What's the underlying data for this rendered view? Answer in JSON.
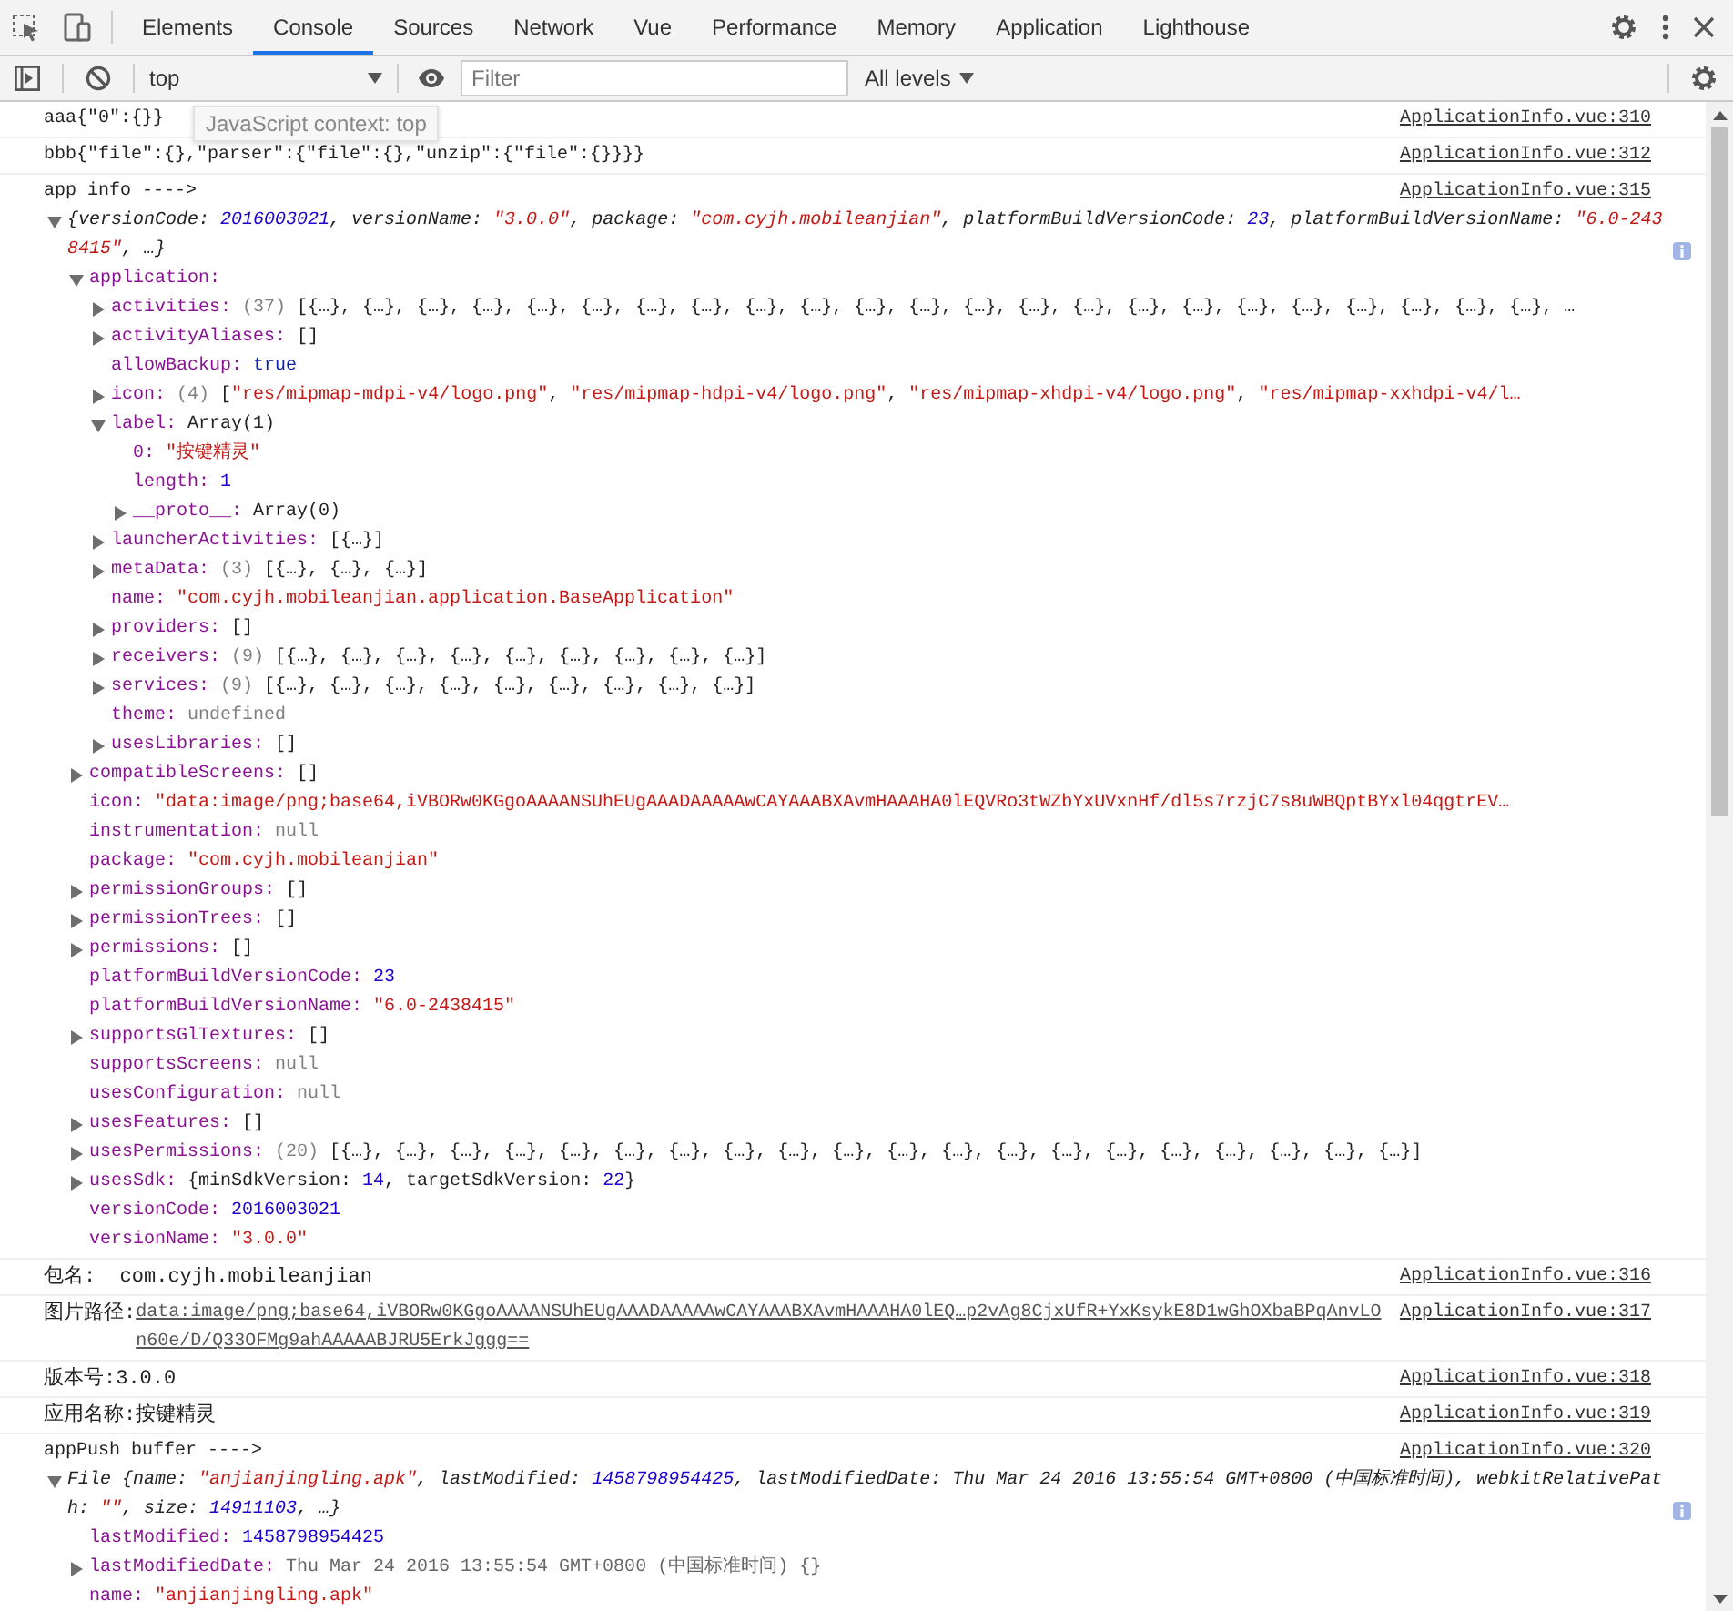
{
  "tabs": [
    {
      "label": "Elements",
      "selected": false
    },
    {
      "label": "Console",
      "selected": true
    },
    {
      "label": "Sources",
      "selected": false
    },
    {
      "label": "Network",
      "selected": false
    },
    {
      "label": "Vue",
      "selected": false
    },
    {
      "label": "Performance",
      "selected": false
    },
    {
      "label": "Memory",
      "selected": false
    },
    {
      "label": "Application",
      "selected": false
    },
    {
      "label": "Lighthouse",
      "selected": false
    }
  ],
  "toolbar": {
    "context": "top",
    "filter_placeholder": "Filter",
    "levels": "All levels"
  },
  "tooltip": "JavaScript context: top",
  "messages": [
    {
      "kind": "log",
      "text": "aaa{\"0\":{}}",
      "source": "ApplicationInfo.vue:310"
    },
    {
      "kind": "log",
      "text": "bbb{\"file\":{},\"parser\":{\"file\":{},\"unzip\":{\"file\":{}}}}",
      "source": "ApplicationInfo.vue:312"
    },
    {
      "kind": "object",
      "text": "app info ---->",
      "source": "ApplicationInfo.vue:315",
      "expanded": true,
      "summary": [
        {
          "kind": "plain",
          "text": "{versionCode: "
        },
        {
          "kind": "number",
          "text": "2016003021"
        },
        {
          "kind": "plain",
          "text": ", versionName: "
        },
        {
          "kind": "string",
          "text": "\"3.0.0\""
        },
        {
          "kind": "plain",
          "text": ", package: "
        },
        {
          "kind": "string",
          "text": "\"com.cyjh.mobileanjian\""
        },
        {
          "kind": "plain",
          "text": ", platformBuildVersionCode: "
        },
        {
          "kind": "number",
          "text": "23"
        },
        {
          "kind": "plain",
          "text": ", platformBuildVersionName: "
        },
        {
          "kind": "string",
          "text": "\"6.0-2438415\""
        },
        {
          "kind": "plain",
          "text": ", …}"
        }
      ],
      "children": [
        {
          "key": "application:",
          "kind": "branch",
          "expanded": true,
          "children": [
            {
              "key": "activities:",
              "kind": "branch",
              "expanded": false,
              "value": [
                {
                  "kind": "count",
                  "text": "(37)"
                },
                {
                  "kind": "plain",
                  "text": " [{…}, {…}, {…}, {…}, {…}, {…}, {…}, {…}, {…}, {…}, {…}, {…}, {…}, {…}, {…}, {…}, {…}, {…}, {…}, {…}, {…}, {…}, {…}, …"
                }
              ]
            },
            {
              "key": "activityAliases:",
              "kind": "branch",
              "expanded": false,
              "value": [
                {
                  "kind": "plain",
                  "text": "[]"
                }
              ]
            },
            {
              "key": "allowBackup:",
              "kind": "leaf",
              "value": [
                {
                  "kind": "boolean",
                  "text": "true"
                }
              ]
            },
            {
              "key": "icon:",
              "kind": "branch",
              "expanded": false,
              "value": [
                {
                  "kind": "count",
                  "text": "(4)"
                },
                {
                  "kind": "plain",
                  "text": " ["
                },
                {
                  "kind": "string",
                  "text": "\"res/mipmap-mdpi-v4/logo.png\""
                },
                {
                  "kind": "plain",
                  "text": ", "
                },
                {
                  "kind": "string",
                  "text": "\"res/mipmap-hdpi-v4/logo.png\""
                },
                {
                  "kind": "plain",
                  "text": ", "
                },
                {
                  "kind": "string",
                  "text": "\"res/mipmap-xhdpi-v4/logo.png\""
                },
                {
                  "kind": "plain",
                  "text": ", "
                },
                {
                  "kind": "string",
                  "text": "\"res/mipmap-xxhdpi-v4/l…"
                }
              ]
            },
            {
              "key": "label:",
              "kind": "branch",
              "expanded": true,
              "value": [
                {
                  "kind": "plain",
                  "text": "Array(1)"
                }
              ],
              "children": [
                {
                  "key": "0:",
                  "kind": "leaf",
                  "value": [
                    {
                      "kind": "string",
                      "text": "\"按键精灵\""
                    }
                  ]
                },
                {
                  "key": "length:",
                  "kind": "leaf",
                  "value": [
                    {
                      "kind": "number",
                      "text": "1"
                    }
                  ]
                },
                {
                  "key": "__proto__:",
                  "kind": "branch",
                  "expanded": false,
                  "value": [
                    {
                      "kind": "plain",
                      "text": "Array(0)"
                    }
                  ]
                }
              ]
            },
            {
              "key": "launcherActivities:",
              "kind": "branch",
              "expanded": false,
              "value": [
                {
                  "kind": "plain",
                  "text": "[{…}]"
                }
              ]
            },
            {
              "key": "metaData:",
              "kind": "branch",
              "expanded": false,
              "value": [
                {
                  "kind": "count",
                  "text": "(3)"
                },
                {
                  "kind": "plain",
                  "text": " [{…}, {…}, {…}]"
                }
              ]
            },
            {
              "key": "name:",
              "kind": "leaf",
              "value": [
                {
                  "kind": "string",
                  "text": "\"com.cyjh.mobileanjian.application.BaseApplication\""
                }
              ]
            },
            {
              "key": "providers:",
              "kind": "branch",
              "expanded": false,
              "value": [
                {
                  "kind": "plain",
                  "text": "[]"
                }
              ]
            },
            {
              "key": "receivers:",
              "kind": "branch",
              "expanded": false,
              "value": [
                {
                  "kind": "count",
                  "text": "(9)"
                },
                {
                  "kind": "plain",
                  "text": " [{…}, {…}, {…}, {…}, {…}, {…}, {…}, {…}, {…}]"
                }
              ]
            },
            {
              "key": "services:",
              "kind": "branch",
              "expanded": false,
              "value": [
                {
                  "kind": "count",
                  "text": "(9)"
                },
                {
                  "kind": "plain",
                  "text": " [{…}, {…}, {…}, {…}, {…}, {…}, {…}, {…}, {…}]"
                }
              ]
            },
            {
              "key": "theme:",
              "kind": "leaf",
              "value": [
                {
                  "kind": "null",
                  "text": "undefined"
                }
              ]
            },
            {
              "key": "usesLibraries:",
              "kind": "branch",
              "expanded": false,
              "value": [
                {
                  "kind": "plain",
                  "text": "[]"
                }
              ]
            }
          ]
        },
        {
          "key": "compatibleScreens:",
          "kind": "branch",
          "expanded": false,
          "value": [
            {
              "kind": "plain",
              "text": "[]"
            }
          ]
        },
        {
          "key": "icon:",
          "kind": "leaf",
          "value": [
            {
              "kind": "string",
              "text": "\"data:image/png;base64,iVBORw0KGgoAAAANSUhEUgAAADAAAAAwCAYAAABXAvmHAAAHA0lEQVRo3tWZbYxUVxnHf/dl5s7rzjC7s8uWBQptBYxl04qgtrEV…"
            }
          ]
        },
        {
          "key": "instrumentation:",
          "kind": "leaf",
          "value": [
            {
              "kind": "null",
              "text": "null"
            }
          ]
        },
        {
          "key": "package:",
          "kind": "leaf",
          "value": [
            {
              "kind": "string",
              "text": "\"com.cyjh.mobileanjian\""
            }
          ]
        },
        {
          "key": "permissionGroups:",
          "kind": "branch",
          "expanded": false,
          "value": [
            {
              "kind": "plain",
              "text": "[]"
            }
          ]
        },
        {
          "key": "permissionTrees:",
          "kind": "branch",
          "expanded": false,
          "value": [
            {
              "kind": "plain",
              "text": "[]"
            }
          ]
        },
        {
          "key": "permissions:",
          "kind": "branch",
          "expanded": false,
          "value": [
            {
              "kind": "plain",
              "text": "[]"
            }
          ]
        },
        {
          "key": "platformBuildVersionCode:",
          "kind": "leaf",
          "value": [
            {
              "kind": "number",
              "text": "23"
            }
          ]
        },
        {
          "key": "platformBuildVersionName:",
          "kind": "leaf",
          "value": [
            {
              "kind": "string",
              "text": "\"6.0-2438415\""
            }
          ]
        },
        {
          "key": "supportsGlTextures:",
          "kind": "branch",
          "expanded": false,
          "value": [
            {
              "kind": "plain",
              "text": "[]"
            }
          ]
        },
        {
          "key": "supportsScreens:",
          "kind": "leaf",
          "value": [
            {
              "kind": "null",
              "text": "null"
            }
          ]
        },
        {
          "key": "usesConfiguration:",
          "kind": "leaf",
          "value": [
            {
              "kind": "null",
              "text": "null"
            }
          ]
        },
        {
          "key": "usesFeatures:",
          "kind": "branch",
          "expanded": false,
          "value": [
            {
              "kind": "plain",
              "text": "[]"
            }
          ]
        },
        {
          "key": "usesPermissions:",
          "kind": "branch",
          "expanded": false,
          "value": [
            {
              "kind": "count",
              "text": "(20)"
            },
            {
              "kind": "plain",
              "text": " [{…}, {…}, {…}, {…}, {…}, {…}, {…}, {…}, {…}, {…}, {…}, {…}, {…}, {…}, {…}, {…}, {…}, {…}, {…}, {…}]"
            }
          ]
        },
        {
          "key": "usesSdk:",
          "kind": "branch",
          "expanded": false,
          "value": [
            {
              "kind": "plain",
              "text": "{minSdkVersion: "
            },
            {
              "kind": "number",
              "text": "14"
            },
            {
              "kind": "plain",
              "text": ", targetSdkVersion: "
            },
            {
              "kind": "number",
              "text": "22"
            },
            {
              "kind": "plain",
              "text": "}"
            }
          ]
        },
        {
          "key": "versionCode:",
          "kind": "leaf",
          "value": [
            {
              "kind": "number",
              "text": "2016003021"
            }
          ]
        },
        {
          "key": "versionName:",
          "kind": "leaf",
          "value": [
            {
              "kind": "string",
              "text": "\"3.0.0\""
            }
          ]
        }
      ]
    },
    {
      "kind": "log",
      "text": "包名:  com.cyjh.mobileanjian",
      "source": "ApplicationInfo.vue:316"
    },
    {
      "kind": "link",
      "text": "图片路径:",
      "link": "data:image/png;base64,iVBORw0KGgoAAAANSUhEUgAAADAAAAAwCAYAAABXAvmHAAAHA0lEQ…p2vAg8CjxUfR+YxKsykE8D1wGhOXbaBPqAnvLOn60e/D/Q33OFMg9ahAAAAABJRU5ErkJggg==",
      "source": "ApplicationInfo.vue:317"
    },
    {
      "kind": "log",
      "text": "版本号:3.0.0",
      "source": "ApplicationInfo.vue:318"
    },
    {
      "kind": "log",
      "text": "应用名称:按键精灵",
      "source": "ApplicationInfo.vue:319"
    },
    {
      "kind": "object",
      "text": "appPush buffer ---->",
      "source": "ApplicationInfo.vue:320",
      "expanded": true,
      "summary": [
        {
          "kind": "plain",
          "text": "File {name: "
        },
        {
          "kind": "string",
          "text": "\"anjianjingling.apk\""
        },
        {
          "kind": "plain",
          "text": ", lastModified: "
        },
        {
          "kind": "number",
          "text": "1458798954425"
        },
        {
          "kind": "plain",
          "text": ", lastModifiedDate: Thu Mar 24 2016 13:55:54 GMT+0800 (中国标准时间), webkitRelativePath: "
        },
        {
          "kind": "string",
          "text": "\"\""
        },
        {
          "kind": "plain",
          "text": ", size: "
        },
        {
          "kind": "number",
          "text": "14911103"
        },
        {
          "kind": "plain",
          "text": ", …}"
        }
      ],
      "children": [
        {
          "key": "lastModified:",
          "kind": "leaf",
          "value": [
            {
              "kind": "number",
              "text": "1458798954425"
            }
          ]
        },
        {
          "key": "lastModifiedDate:",
          "kind": "branch",
          "expanded": false,
          "value": [
            {
              "kind": "date",
              "text": "Thu Mar 24 2016 13:55:54 GMT+0800 (中国标准时间) {}"
            }
          ]
        },
        {
          "key": "name:",
          "kind": "leaf",
          "value": [
            {
              "kind": "string",
              "text": "\"anjianjingling.apk\""
            }
          ]
        }
      ]
    }
  ]
}
